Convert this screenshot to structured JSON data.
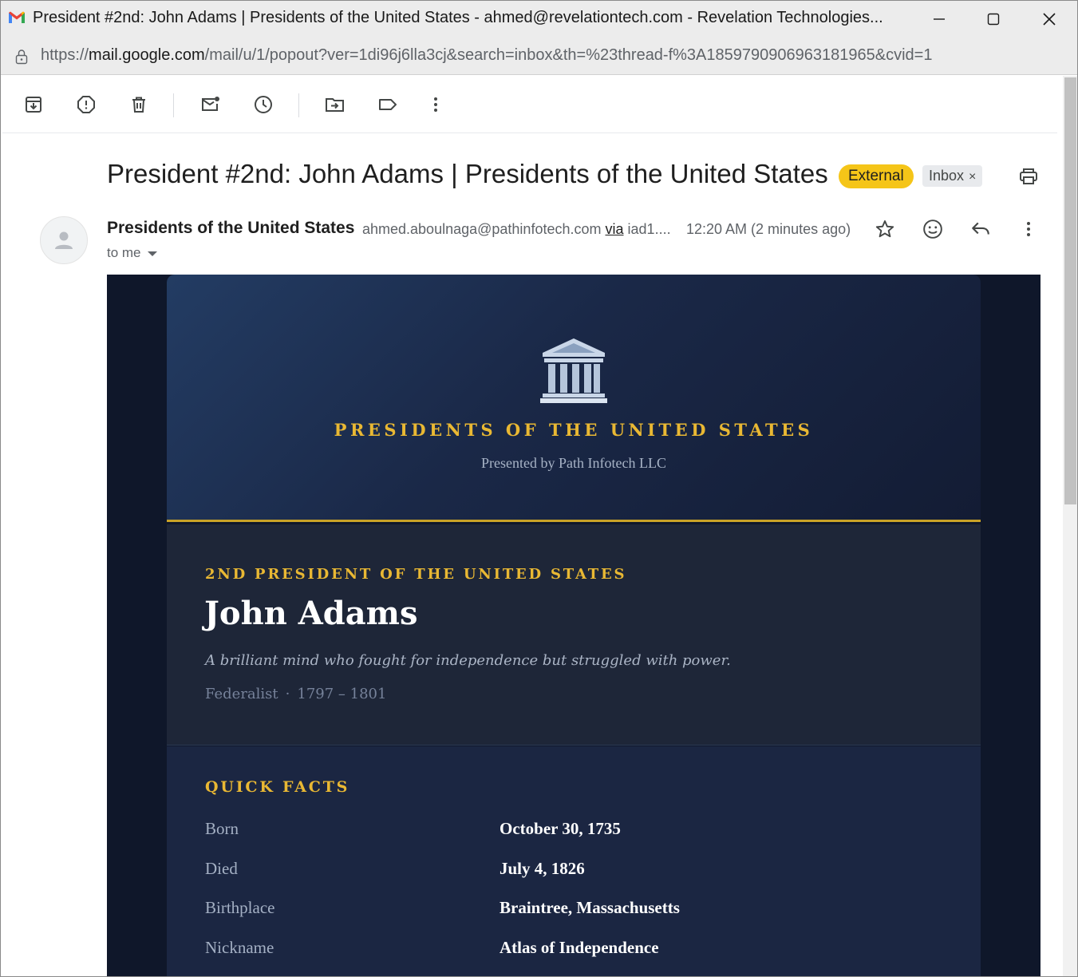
{
  "window": {
    "title": "President #2nd: John Adams | Presidents of the United States - ahmed@revelationtech.com - Revelation Technologies...",
    "url_prefix": "https://",
    "url_host": "mail.google.com",
    "url_rest": "/mail/u/1/popout?ver=1di96j6lla3cj&search=inbox&th=%23thread-f%3A1859790906963181965&cvid=1"
  },
  "toolbar": {
    "icons": [
      "archive-icon",
      "report-spam-icon",
      "delete-icon",
      "mark-unread-icon",
      "snooze-icon",
      "move-to-icon",
      "label-icon",
      "more-vert-icon"
    ]
  },
  "message": {
    "subject": "President #2nd: John Adams | Presidents of the United States",
    "badge_external": "External",
    "badge_inbox": "Inbox",
    "badge_inbox_remove": "×",
    "sender_name": "Presidents of the United States",
    "sender_email": "ahmed.aboulnaga@pathinfotech.com",
    "via_label": "via",
    "via_host": "iad1....",
    "time": "12:20 AM (2 minutes ago)",
    "recipient": "to me"
  },
  "email": {
    "org_title": "PRESIDENTS OF THE UNITED STATES",
    "presented_by": "Presented by Path Infotech LLC",
    "ordinal": "2ND PRESIDENT OF THE UNITED STATES",
    "name": "John Adams",
    "tagline": "A brilliant mind who fought for independence but struggled with power.",
    "party": "Federalist",
    "separator": "·",
    "term": "1797 – 1801",
    "facts_title": "QUICK FACTS",
    "facts": [
      {
        "label": "Born",
        "value": "October 30, 1735"
      },
      {
        "label": "Died",
        "value": "July 4, 1826"
      },
      {
        "label": "Birthplace",
        "value": "Braintree, Massachusetts"
      },
      {
        "label": "Nickname",
        "value": "Atlas of Independence"
      }
    ]
  },
  "colors": {
    "accent_gold": "#e9b833",
    "badge_external": "#f5c518",
    "email_bg": "#0f172a"
  }
}
